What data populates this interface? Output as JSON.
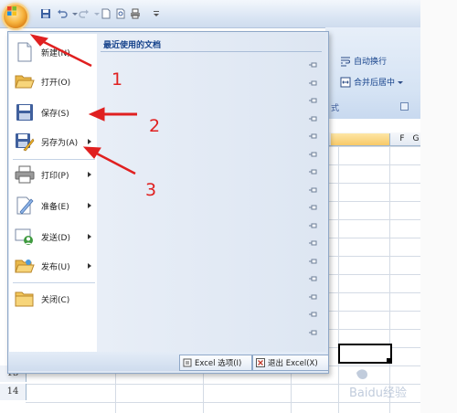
{
  "ribbon": {
    "wrap_text": "自动换行",
    "merge_center": "合并后居中",
    "group_label": "对齐方式",
    "group_label_visible": "式"
  },
  "sheet": {
    "col_f": "F",
    "col_g": "G",
    "row_13": "13",
    "row_14": "14"
  },
  "menu": {
    "items": [
      {
        "label": "新建(N)",
        "icon": "new-document-icon",
        "submenu": false
      },
      {
        "label": "打开(O)",
        "icon": "open-folder-icon",
        "submenu": false
      },
      {
        "label": "保存(S)",
        "icon": "save-icon",
        "submenu": false
      },
      {
        "label": "另存为(A)",
        "icon": "save-as-icon",
        "submenu": true
      },
      {
        "label": "打印(P)",
        "icon": "printer-icon",
        "submenu": true
      },
      {
        "label": "准备(E)",
        "icon": "prepare-icon",
        "submenu": true
      },
      {
        "label": "发送(D)",
        "icon": "send-icon",
        "submenu": true
      },
      {
        "label": "发布(U)",
        "icon": "publish-icon",
        "submenu": true
      },
      {
        "label": "关闭(C)",
        "icon": "close-folder-icon",
        "submenu": false
      }
    ],
    "recent_title": "最近使用的文档",
    "options_button": "Excel 选项(I)",
    "exit_button": "退出 Excel(X)"
  },
  "annotations": {
    "n1": "1",
    "n2": "2",
    "n3": "3"
  },
  "watermark": "Baidu经验",
  "colors": {
    "arrow": "#e02020",
    "menu_bg": "#dfe8f4",
    "accent": "#15428b"
  }
}
